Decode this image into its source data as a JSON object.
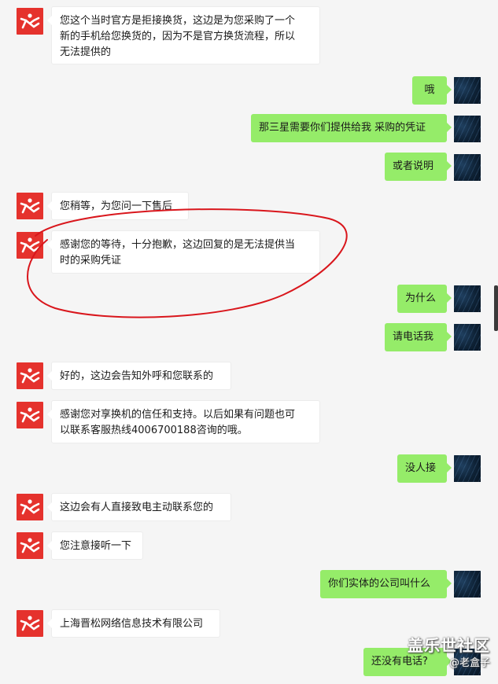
{
  "messages": [
    {
      "side": "in",
      "text": "您这个当时官方是拒接换货，这边是为您采购了一个\n新的手机给您换货的，因为不是官方换货流程，所以\n无法提供的"
    },
    {
      "side": "out",
      "text": "哦"
    },
    {
      "side": "out",
      "text": "那三星需要你们提供给我 采购的凭证"
    },
    {
      "side": "out",
      "text": "或者说明"
    },
    {
      "side": "in",
      "text": "您稍等，为您问一下售后"
    },
    {
      "side": "in",
      "text": "感谢您的等待，十分抱歉，这边回复的是无法提供当\n时的采购凭证"
    },
    {
      "side": "out",
      "text": "为什么"
    },
    {
      "side": "out",
      "text": "请电话我"
    },
    {
      "side": "in",
      "text": "好的，这边会告知外呼和您联系的"
    },
    {
      "side": "in",
      "text": "感谢您对享换机的信任和支持。以后如果有问题也可\n以联系客服热线4006700188咨询的哦。"
    },
    {
      "side": "out",
      "text": "没人接"
    },
    {
      "side": "in",
      "text": "这边会有人直接致电主动联系您的"
    },
    {
      "side": "in",
      "text": "您注意接听一下"
    },
    {
      "side": "out",
      "text": "你们实体的公司叫什么"
    },
    {
      "side": "in",
      "text": "上海晋松网络信息技术有限公司"
    },
    {
      "side": "out",
      "text": "还没有电话?"
    }
  ],
  "watermark": {
    "main": "盖乐世社区",
    "sub": "@老盒子"
  },
  "colors": {
    "outgoing": "#95ec69",
    "incoming": "#ffffff",
    "brand": "#e5322d",
    "annotation": "#d9161c"
  },
  "icons": {
    "brand_avatar": "xianghuanji-logo-icon",
    "user_avatar": "user-avatar-image"
  }
}
